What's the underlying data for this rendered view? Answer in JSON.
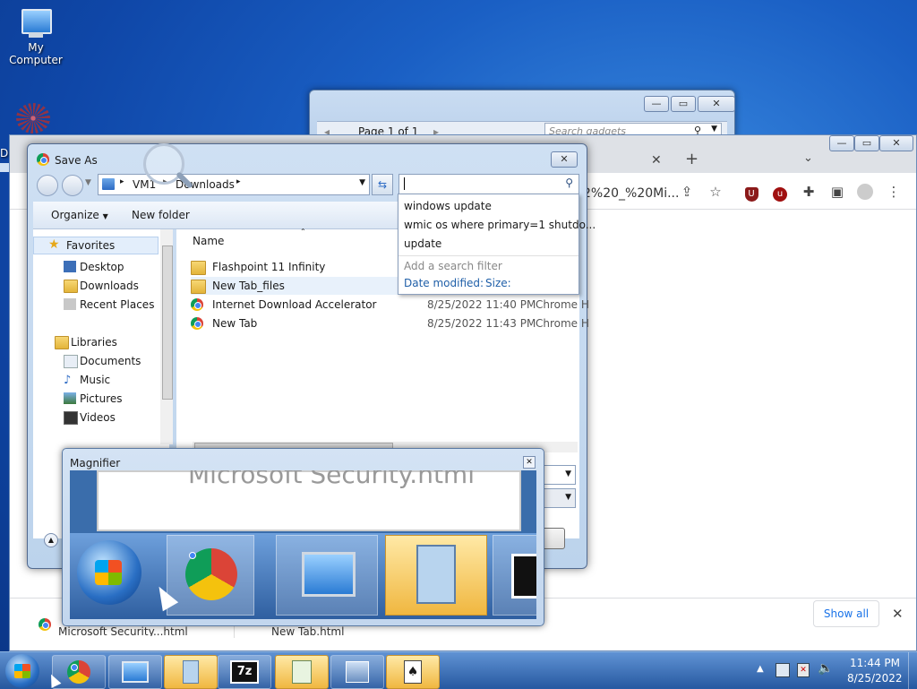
{
  "desktop": {
    "my_computer_label": "My Computer",
    "partial_label": "D"
  },
  "gadgets_window": {
    "page_label": "Page 1 of 1",
    "search_placeholder": "Search gadgets"
  },
  "chrome_window": {
    "url_fragment": "2%20_%20Mi...",
    "show_all_label": "Show all",
    "download_items": [
      "Microsoft Security...html",
      "New Tab.html"
    ]
  },
  "save_as": {
    "title": "Save As",
    "breadcrumb": [
      "VM1",
      "Downloads"
    ],
    "organize_label": "Organize",
    "new_folder_label": "New folder",
    "column_name": "Name",
    "nav": {
      "favorites": "Favorites",
      "favorites_items": [
        "Desktop",
        "Downloads",
        "Recent Places"
      ],
      "libraries": "Libraries",
      "libraries_items": [
        "Documents",
        "Music",
        "Pictures",
        "Videos"
      ]
    },
    "files": [
      {
        "name": "Flashpoint 11 Infinity",
        "date": "",
        "type": "",
        "kind": "folder"
      },
      {
        "name": "New Tab_files",
        "date": "",
        "type": "",
        "kind": "folder"
      },
      {
        "name": "Internet Download Accelerator",
        "date": "8/25/2022 11:40 PM",
        "type": "Chrome H",
        "kind": "chrome"
      },
      {
        "name": "New Tab",
        "date": "8/25/2022 11:43 PM",
        "type": "Chrome H",
        "kind": "chrome"
      }
    ]
  },
  "search_suggestions": {
    "items": [
      "windows update",
      "wmic os where primary=1 shutdo...",
      "update"
    ],
    "add_filter_label": "Add a search filter",
    "filter_date": "Date modified:",
    "filter_size": "Size:"
  },
  "magnifier": {
    "title": "Magnifier",
    "zoomed_text": "Microsoft Security.html"
  },
  "taskbar": {
    "time": "11:44 PM",
    "date": "8/25/2022"
  },
  "colors": {
    "accent": "#1a5fc4",
    "link": "#1f5fa8",
    "taskbar_highlight": "#f0b740"
  }
}
